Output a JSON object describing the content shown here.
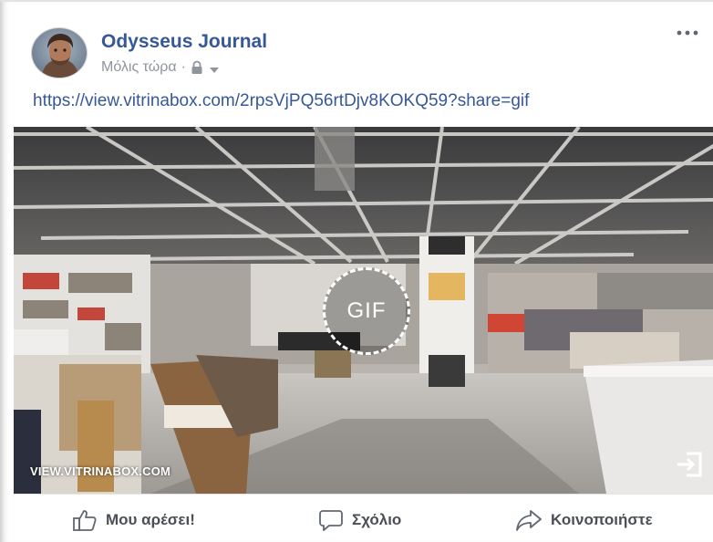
{
  "post": {
    "author": "Odysseus Journal",
    "timestamp": "Μόλις τώρα",
    "separator": "·",
    "privacy_icon": "lock-icon",
    "audience_icon": "caret-down-icon",
    "options_icon": "more-horizontal-icon",
    "link": "https://view.vitrinabox.com/2rpsVjPQ56rtDjv8KOKQ59?share=gif"
  },
  "media": {
    "badge": "GIF",
    "domain": "VIEW.VITRINABOX.COM",
    "open_icon": "open-external-icon"
  },
  "actions": {
    "like": "Μου αρέσει!",
    "comment": "Σχόλιο",
    "share": "Κοινοποιήστε"
  },
  "colors": {
    "link": "#365899",
    "meta": "#90949c",
    "action_text": "#4b4f56"
  }
}
